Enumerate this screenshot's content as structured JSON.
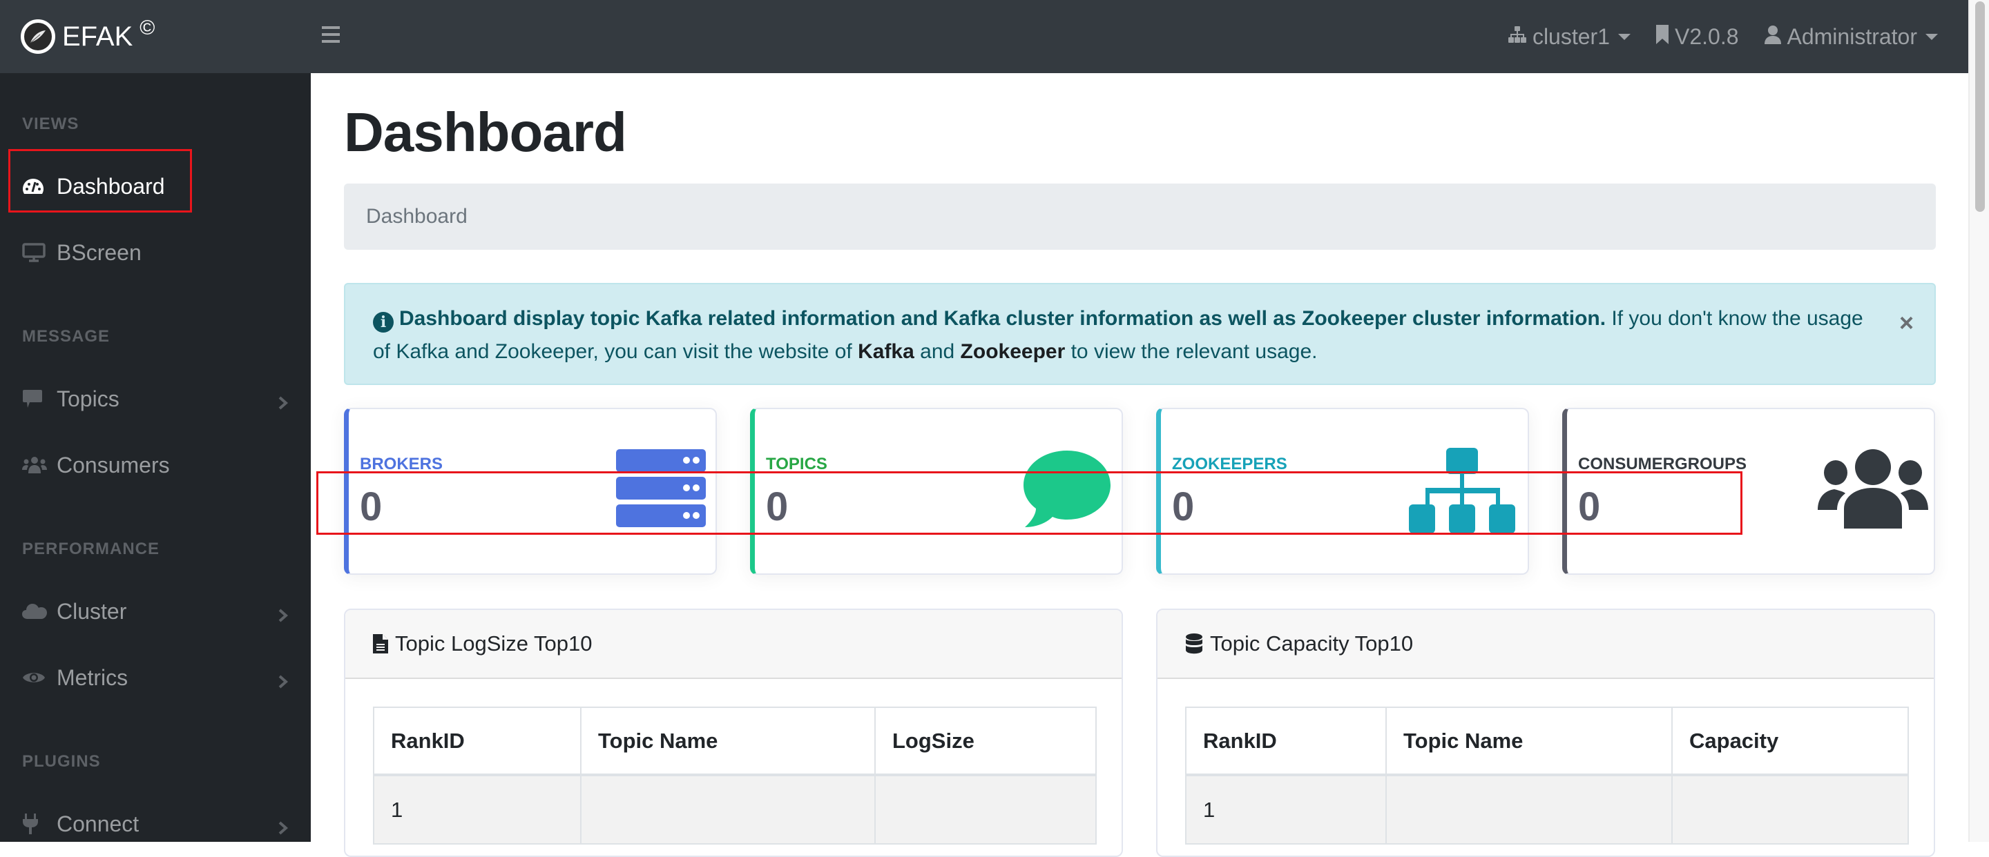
{
  "header": {
    "brand": "EFAK",
    "brand_mark": "©",
    "cluster": "cluster1",
    "version": "V2.0.8",
    "user": "Administrator"
  },
  "sidebar": {
    "sections": [
      {
        "heading": "VIEWS",
        "items": [
          {
            "label": "Dashboard",
            "icon": "tachometer-icon",
            "active": true,
            "has_submenu": false
          },
          {
            "label": "BScreen",
            "icon": "desktop-icon",
            "active": false,
            "has_submenu": false
          }
        ]
      },
      {
        "heading": "MESSAGE",
        "items": [
          {
            "label": "Topics",
            "icon": "comment-icon",
            "active": false,
            "has_submenu": true
          },
          {
            "label": "Consumers",
            "icon": "users-icon",
            "active": false,
            "has_submenu": false
          }
        ]
      },
      {
        "heading": "PERFORMANCE",
        "items": [
          {
            "label": "Cluster",
            "icon": "cloud-icon",
            "active": false,
            "has_submenu": true
          },
          {
            "label": "Metrics",
            "icon": "eye-icon",
            "active": false,
            "has_submenu": true
          }
        ]
      },
      {
        "heading": "PLUGINS",
        "items": [
          {
            "label": "Connect",
            "icon": "plug-icon",
            "active": false,
            "has_submenu": true
          }
        ]
      }
    ]
  },
  "page": {
    "title": "Dashboard",
    "breadcrumb": "Dashboard"
  },
  "alert": {
    "bold": "Dashboard display topic Kafka related information and Kafka cluster information as well as Zookeeper cluster information.",
    "text1": " If you don't know the usage of Kafka and Zookeeper, you can visit the website of ",
    "link1": "Kafka",
    "text2": " and ",
    "link2": "Zookeeper",
    "text3": " to view the relevant usage.",
    "close": "×"
  },
  "stats": [
    {
      "label": "BROKERS",
      "value": "0",
      "color": "#4e73df",
      "icon": "server-icon"
    },
    {
      "label": "TOPICS",
      "value": "0",
      "color": "#1cc88a",
      "label_color": "#28a745",
      "icon": "comment-icon"
    },
    {
      "label": "ZOOKEEPERS",
      "value": "0",
      "color": "#36b9cc",
      "label_color": "#17a2b8",
      "icon": "sitemap-icon"
    },
    {
      "label": "CONSUMERGROUPS",
      "value": "0",
      "color": "#5a5c69",
      "label_color": "#343a40",
      "icon": "users-icon"
    }
  ],
  "panels": [
    {
      "title": "Topic LogSize Top10",
      "icon": "file-icon",
      "columns": [
        "RankID",
        "Topic Name",
        "LogSize"
      ],
      "rows": [
        [
          "1",
          "",
          ""
        ]
      ]
    },
    {
      "title": "Topic Capacity Top10",
      "icon": "database-icon",
      "columns": [
        "RankID",
        "Topic Name",
        "Capacity"
      ],
      "rows": [
        [
          "1",
          "",
          ""
        ]
      ]
    }
  ]
}
